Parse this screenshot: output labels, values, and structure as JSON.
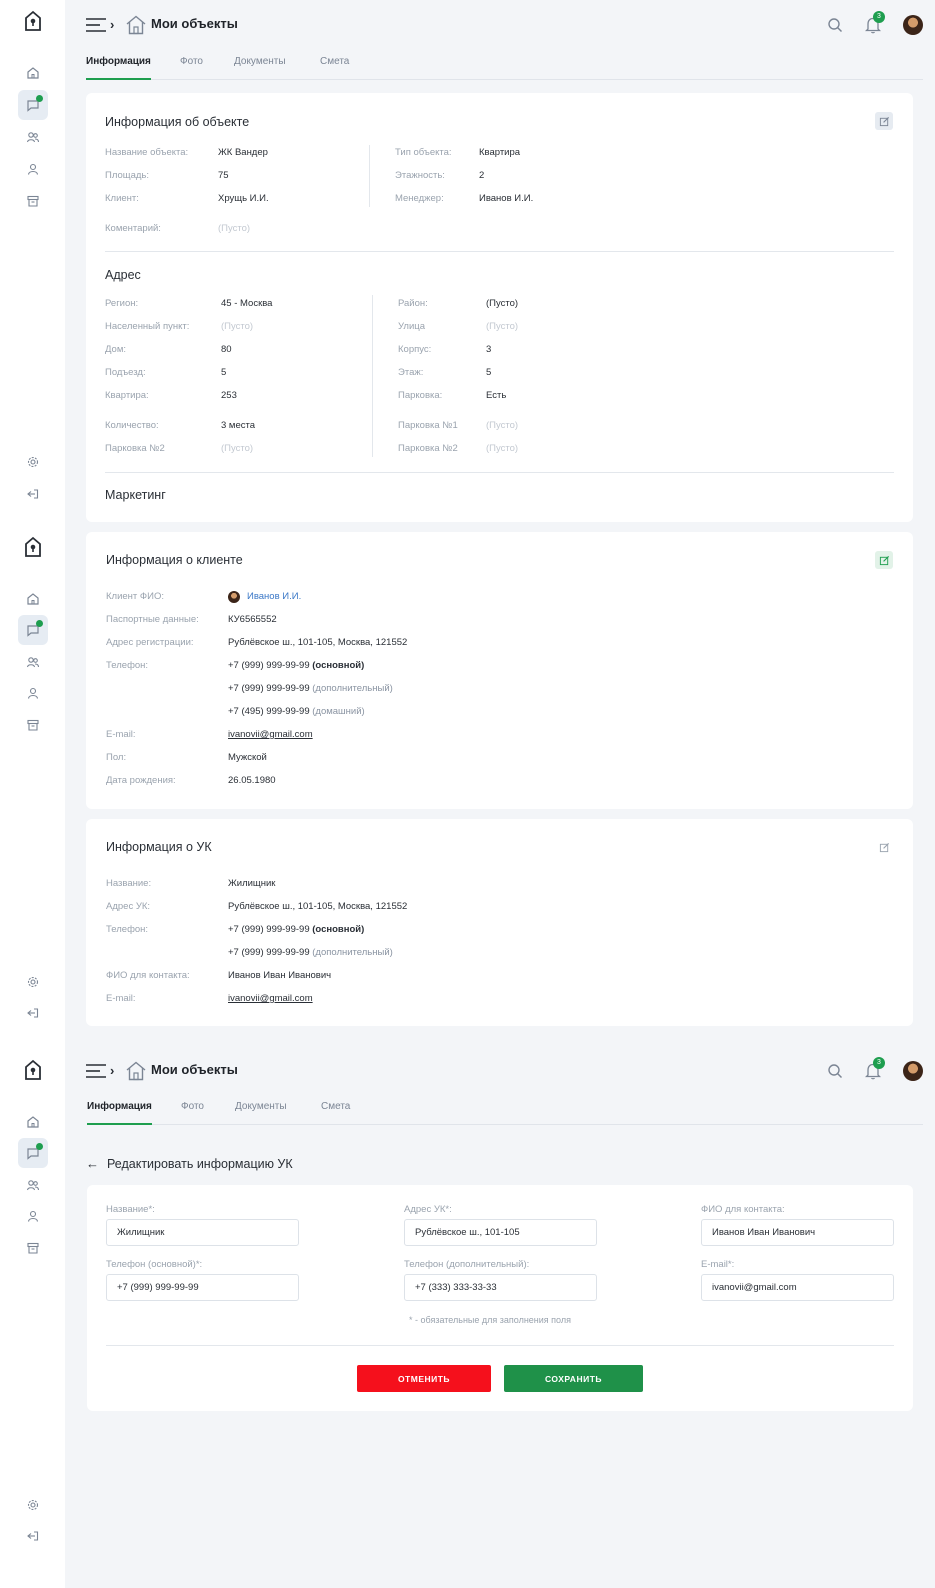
{
  "colors": {
    "accent": "#1e9e4f",
    "cancel": "#f5101c",
    "save": "#1f9149",
    "link": "#3b78c7"
  },
  "header": {
    "title": "Мои объекты",
    "notification_count": "3"
  },
  "tabs": [
    {
      "label": "Информация"
    },
    {
      "label": "Фото"
    },
    {
      "label": "Документы"
    },
    {
      "label": "Смета"
    }
  ],
  "empty": "(Пусто)",
  "object_info": {
    "title": "Информация об объекте",
    "name_label": "Название объекта:",
    "name": "ЖК Вандер",
    "area_label": "Площадь:",
    "area": "75",
    "client_label": "Клиент:",
    "client": "Хрущь И.И.",
    "type_label": "Тип объекта:",
    "type": "Квартира",
    "floors_label": "Этажность:",
    "floors": "2",
    "manager_label": "Менеджер:",
    "manager": "Иванов И.И.",
    "comment_label": "Коментарий:"
  },
  "address": {
    "title": "Адрес",
    "region_label": "Регион:",
    "region": "45 - Москва",
    "locality_label": "Населенный пункт:",
    "house_label": "Дом:",
    "house": "80",
    "entrance_label": "Подъезд:",
    "entrance": "5",
    "apartment_label": "Квартира:",
    "apartment": "253",
    "count_label": "Количество:",
    "count": "3 места",
    "parking2_label": "Парковка №2",
    "district_label": "Район:",
    "district": "(Пусто)",
    "street_label": "Улица",
    "building_label": "Корпус:",
    "building": "3",
    "floor_label": "Этаж:",
    "floor": "5",
    "parking_label": "Парковка:",
    "parking": "Есть",
    "parking1_label": "Парковка №1",
    "parking2b_label": "Парковка №2"
  },
  "marketing": {
    "title": "Маркетинг"
  },
  "client_info": {
    "title": "Информация о клиенте",
    "fio_label": "Клиент ФИО:",
    "fio": "Иванов И.И.",
    "passport_label": "Паспортные данные:",
    "passport": "КУ6565552",
    "reg_label": "Адрес регистрации:",
    "reg": "Рублёвское ш., 101-105, Москва, 121552",
    "phone_label": "Телефон:",
    "phone1": "+7 (999) 999-99-99",
    "phone1_type": "(основной)",
    "phone2": "+7 (999) 999-99-99",
    "phone2_type": "(дополнительный)",
    "phone3": "+7 (495) 999-99-99",
    "phone3_type": "(домашний)",
    "email_label": "E-mail:",
    "email": "ivanovii@gmail.com",
    "gender_label": "Пол:",
    "gender": "Мужской",
    "birth_label": "Дата рождения:",
    "birth": "26.05.1980"
  },
  "uk_info": {
    "title": "Информация о УК",
    "name_label": "Название:",
    "name": "Жилищник",
    "addr_label": "Адрес УК:",
    "addr": "Рублёвское ш., 101-105, Москва, 121552",
    "phone_label": "Телефон:",
    "phone1": "+7 (999) 999-99-99",
    "phone1_type": "(основной)",
    "phone2": "+7 (999) 999-99-99",
    "phone2_type": "(дополнительный)",
    "contact_label": "ФИО для контакта:",
    "contact": "Иванов Иван Иванович",
    "email_label": "E-mail:",
    "email": "ivanovii@gmail.com"
  },
  "edit_form": {
    "title": "Редактировать информацию УК",
    "name_label": "Название*:",
    "name": "Жилищник",
    "addr_label": "Адрес УК*:",
    "addr": "Рублёвское ш., 101-105",
    "contact_label": "ФИО для контакта:",
    "contact": "Иванов Иван Иванович",
    "phone_main_label": "Телефон (основной)*:",
    "phone_main": "+7 (999) 999-99-99",
    "phone_extra_label": "Телефон (дополнительный):",
    "phone_extra": "+7 (333) 333-33-33",
    "email_label": "E-mail*:",
    "email": "ivanovii@gmail.com",
    "required_note": "* - обязательные для заполнения поля",
    "cancel_label": "ОТМЕНИТЬ",
    "save_label": "СОХРАНИТЬ"
  }
}
